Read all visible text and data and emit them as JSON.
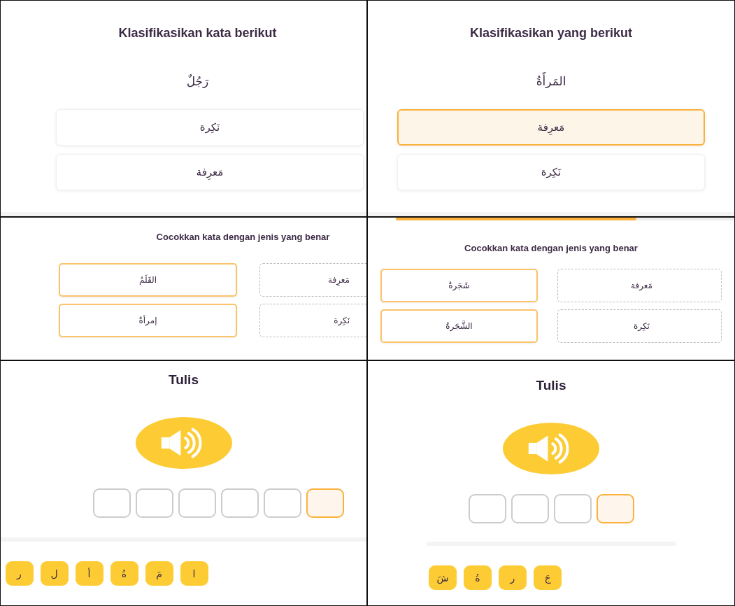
{
  "left_column": [
    {
      "kind": "classify",
      "title": "Klasifikasikan kata berikut",
      "word": "رَجُلٌ",
      "options": [
        {
          "label": "نَكِرة",
          "selected": false
        },
        {
          "label": "مَعرِفة",
          "selected": false
        }
      ]
    },
    {
      "kind": "match",
      "title": "Cocokkan kata dengan jenis yang benar",
      "words": [
        {
          "label": "القَلَمُ"
        },
        {
          "label": "إمرأةٌ"
        }
      ],
      "types": [
        {
          "label": "مَعرِفة"
        },
        {
          "label": "نَكِرة"
        }
      ]
    },
    {
      "kind": "write",
      "title": "Tulis",
      "slots": [
        {
          "selected": true
        },
        {
          "selected": false
        },
        {
          "selected": false
        },
        {
          "selected": false
        },
        {
          "selected": false
        },
        {
          "selected": false
        }
      ],
      "letters": [
        "ا",
        "مَ",
        "ةُ",
        "أ",
        "ل",
        "ر"
      ]
    }
  ],
  "right_column": [
    {
      "kind": "classify",
      "title": "Klasifikasikan yang berikut",
      "word": "المَرأَةُ",
      "options": [
        {
          "label": "مَعرِفة",
          "selected": true
        },
        {
          "label": "نَكِرة",
          "selected": false
        }
      ]
    },
    {
      "kind": "match",
      "title": "Cocokkan kata dengan jenis yang benar",
      "progress": {
        "level": 0.71
      },
      "words": [
        {
          "label": "شَجَرةٌ"
        },
        {
          "label": "الشَّجَرةُ"
        }
      ],
      "types": [
        {
          "label": "مَعرفة"
        },
        {
          "label": "نَكِرة"
        }
      ]
    },
    {
      "kind": "write",
      "title": "Tulis",
      "slots": [
        {
          "selected": true
        },
        {
          "selected": false
        },
        {
          "selected": false
        },
        {
          "selected": false
        }
      ],
      "letters": [
        "جَ",
        "ر",
        "ةُ",
        "شَ"
      ]
    }
  ]
}
